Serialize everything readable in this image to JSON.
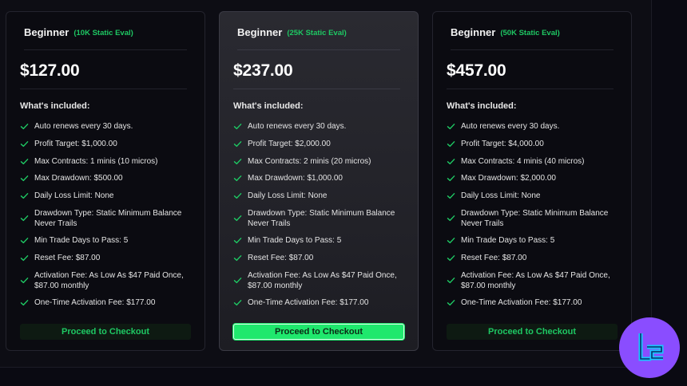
{
  "plans": [
    {
      "tier": "Beginner",
      "tag": "(10K Static Eval)",
      "price": "$127.00",
      "included_label": "What's included:",
      "features": [
        "Auto renews every 30 days.",
        "Profit Target: $1,000.00",
        "Max Contracts: 1 minis (10 micros)",
        "Max Drawdown: $500.00",
        "Daily Loss Limit: None",
        "Drawdown Type: Static Minimum Balance Never Trails",
        "Min Trade Days to Pass: 5",
        "Reset Fee: $87.00",
        "Activation Fee: As Low As $47 Paid Once, $87.00 monthly",
        "One-Time Activation Fee: $177.00"
      ],
      "cta": "Proceed to Checkout",
      "featured": false
    },
    {
      "tier": "Beginner",
      "tag": "(25K Static Eval)",
      "price": "$237.00",
      "included_label": "What's included:",
      "features": [
        "Auto renews every 30 days.",
        "Profit Target: $2,000.00",
        "Max Contracts: 2 minis (20 micros)",
        "Max Drawdown: $1,000.00",
        "Daily Loss Limit: None",
        "Drawdown Type: Static Minimum Balance Never Trails",
        "Min Trade Days to Pass: 5",
        "Reset Fee: $87.00",
        "Activation Fee: As Low As $47 Paid Once, $87.00 monthly",
        "One-Time Activation Fee: $177.00"
      ],
      "cta": "Proceed to Checkout",
      "featured": true
    },
    {
      "tier": "Beginner",
      "tag": "(50K Static Eval)",
      "price": "$457.00",
      "included_label": "What's included:",
      "features": [
        "Auto renews every 30 days.",
        "Profit Target: $4,000.00",
        "Max Contracts: 4 minis (40 micros)",
        "Max Drawdown: $2,000.00",
        "Daily Loss Limit: None",
        "Drawdown Type: Static Minimum Balance Never Trails",
        "Min Trade Days to Pass: 5",
        "Reset Fee: $87.00",
        "Activation Fee: As Low As $47 Paid Once, $87.00 monthly",
        "One-Time Activation Fee: $177.00"
      ],
      "cta": "Proceed to Checkout",
      "featured": false
    }
  ],
  "colors": {
    "accent_green": "#1ec863",
    "cta_featured_bg": "#1fe86d",
    "logo_bg": "#8a4dff",
    "page_bg": "#0a0a12"
  },
  "icons": {
    "feature": "check-icon",
    "logo": "brand-logo-icon"
  }
}
